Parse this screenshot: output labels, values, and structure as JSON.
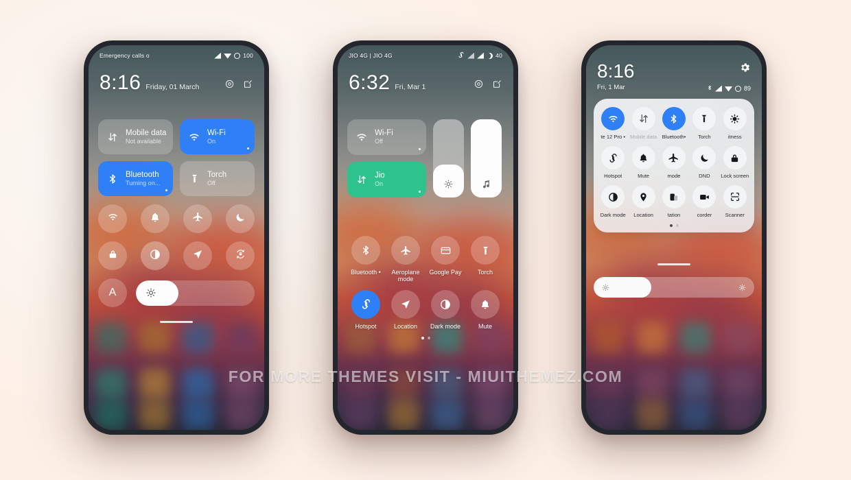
{
  "watermark": {
    "text": "FOR MORE THEMES VISIT - MIUITHEMEZ.COM"
  },
  "colors": {
    "accent_blue": "#2f80f7",
    "accent_green": "#2ec38d",
    "panel_light": "#f3f4f5",
    "page_bg": "#fcefe6",
    "frame": "#23262d"
  },
  "phone1": {
    "status": {
      "carrier": "Emergency calls o",
      "battery": "100",
      "icons": [
        "signal-icon",
        "wifi-icon",
        "battery-circle-icon"
      ]
    },
    "header": {
      "time": "8:16",
      "date": "Friday, 01 March",
      "actions": [
        "settings-gear-icon",
        "edit-icon"
      ]
    },
    "tiles": [
      {
        "name": "Mobile data",
        "sub": "Not available",
        "state": "off",
        "icon": "mobile-data-icon"
      },
      {
        "name": "Wi-Fi",
        "sub": "On",
        "state": "on-blue",
        "icon": "wifi-icon"
      },
      {
        "name": "Bluetooth",
        "sub": "Turning on...",
        "state": "on-blue",
        "icon": "bluetooth-icon"
      },
      {
        "name": "Torch",
        "sub": "Off",
        "state": "off",
        "icon": "torch-icon"
      }
    ],
    "circles_row1": [
      "wifi-icon",
      "bell-icon",
      "airplane-icon",
      "moon-icon"
    ],
    "circles_row2": [
      "lock-icon",
      "contrast-icon",
      "location-arrow-icon",
      "rotation-lock-icon"
    ],
    "auto_brightness_label": "A",
    "brightness_percent": 36
  },
  "phone2": {
    "status": {
      "carrier": "JIO 4G | JIO 4G",
      "battery": "40",
      "icons": [
        "hotspot-icon",
        "signal-weak-icon",
        "signal-icon",
        "dnd-moon-icon"
      ]
    },
    "header": {
      "time": "6:32",
      "date": "Fri, Mar 1",
      "actions": [
        "settings-gear-icon",
        "edit-icon"
      ]
    },
    "tiles": [
      {
        "name": "Wi-Fi",
        "sub": "Off",
        "state": "off",
        "icon": "wifi-icon"
      },
      {
        "name": "Jio",
        "sub": "On",
        "state": "on-green",
        "icon": "mobile-data-icon"
      }
    ],
    "sliders": [
      {
        "name": "brightness",
        "icon": "brightness-icon",
        "percent": 42
      },
      {
        "name": "volume",
        "icon": "music-note-icon",
        "percent": 100
      }
    ],
    "grid_row1": [
      {
        "label": "Bluetooth •",
        "icon": "bluetooth-icon",
        "state": "off"
      },
      {
        "label": "Aeroplane mode",
        "icon": "airplane-icon",
        "state": "off"
      },
      {
        "label": "Google Pay",
        "icon": "card-icon",
        "state": "off"
      },
      {
        "label": "Torch",
        "icon": "torch-icon",
        "state": "off"
      }
    ],
    "grid_row2": [
      {
        "label": "Hotspot",
        "icon": "hotspot-icon",
        "state": "on"
      },
      {
        "label": "Location",
        "icon": "location-arrow-icon",
        "state": "off"
      },
      {
        "label": "Dark mode",
        "icon": "contrast-icon",
        "state": "off"
      },
      {
        "label": "Mute",
        "icon": "bell-icon",
        "state": "off"
      }
    ],
    "page_dots": {
      "count": 2,
      "active": 0
    }
  },
  "phone3": {
    "header": {
      "time": "8:16",
      "date": "Fri, 1 Mar",
      "battery": "89",
      "settings_icon": "gear-icon",
      "status_icons": [
        "bluetooth-icon",
        "signal-icon",
        "wifi-icon",
        "battery-circle-icon"
      ]
    },
    "grid_row1": [
      {
        "label": "te 12 Pro •",
        "icon": "wifi-icon",
        "state": "on"
      },
      {
        "label": "Mobile data",
        "icon": "mobile-data-icon",
        "state": "muted"
      },
      {
        "label": "Bluetooth•",
        "icon": "bluetooth-icon",
        "state": "on"
      },
      {
        "label": "Torch",
        "icon": "torch-icon",
        "state": "off"
      },
      {
        "label": "itness",
        "icon": "brightness-icon",
        "state": "off"
      }
    ],
    "grid_row2": [
      {
        "label": "Hotspot",
        "icon": "hotspot-icon",
        "state": "off"
      },
      {
        "label": "Mute",
        "icon": "bell-icon",
        "state": "off"
      },
      {
        "label": "mode",
        "icon": "airplane-icon",
        "state": "off"
      },
      {
        "label": "DND",
        "icon": "moon-icon",
        "state": "off"
      },
      {
        "label": "Lock screen",
        "icon": "lock-icon",
        "state": "off"
      }
    ],
    "grid_row3": [
      {
        "label": "Dark mode",
        "icon": "contrast-icon",
        "state": "off"
      },
      {
        "label": "Location",
        "icon": "location-pin-icon",
        "state": "off"
      },
      {
        "label": "tation",
        "icon": "rotation-icon",
        "state": "off"
      },
      {
        "label": "corder",
        "icon": "video-camera-icon",
        "state": "off"
      },
      {
        "label": "Scanner",
        "icon": "scanner-icon",
        "state": "off"
      }
    ],
    "page_dots": {
      "count": 2,
      "active": 0
    },
    "brightness_percent": 36,
    "brightness_icons": [
      "brightness-low-icon",
      "brightness-high-icon"
    ]
  }
}
